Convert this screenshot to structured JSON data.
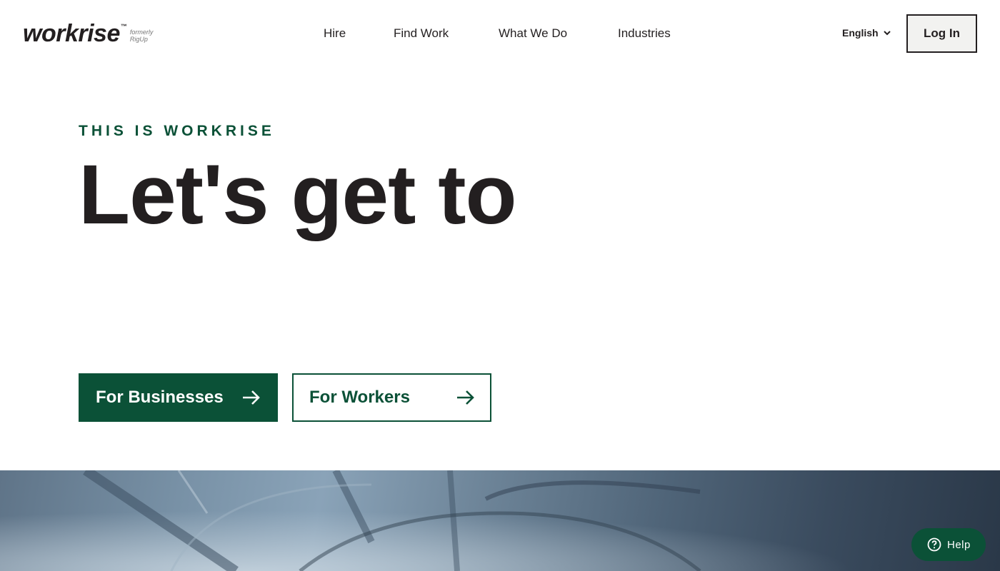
{
  "brand": {
    "logo_text": "workrise",
    "tm": "™",
    "formerly": "formerly RigUp"
  },
  "nav": {
    "items": [
      "Hire",
      "Find Work",
      "What We Do",
      "Industries"
    ]
  },
  "header": {
    "language": "English",
    "login_label": "Log In"
  },
  "hero": {
    "eyebrow": "THIS IS WORKRISE",
    "headline": "Let's get to",
    "cta_business": "For Businesses",
    "cta_workers": "For Workers"
  },
  "help": {
    "label": "Help"
  },
  "colors": {
    "brand_green": "#0b5137",
    "text_dark": "#231f20",
    "login_bg": "#f2f2f0"
  },
  "icons": [
    "chevron-down-icon",
    "arrow-right-icon",
    "help-circle-icon"
  ]
}
